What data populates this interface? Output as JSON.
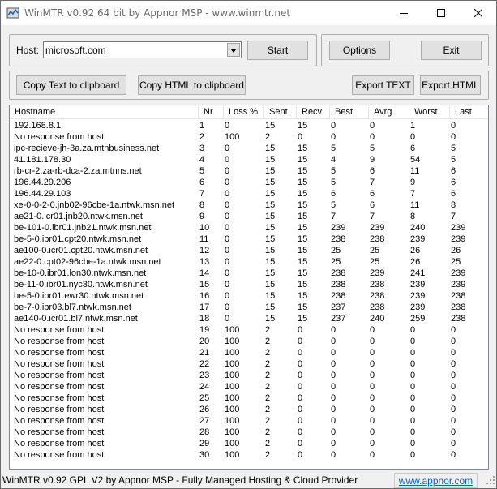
{
  "window": {
    "title": "WinMTR v0.92 64 bit by Appnor MSP - www.winmtr.net"
  },
  "host": {
    "label": "Host:",
    "value": "microsoft.com"
  },
  "buttons": {
    "start": "Start",
    "options": "Options",
    "exit": "Exit",
    "copy_text": "Copy Text to clipboard",
    "copy_html": "Copy HTML to clipboard",
    "export_text": "Export TEXT",
    "export_html": "Export HTML"
  },
  "table": {
    "columns": [
      "Hostname",
      "Nr",
      "Loss %",
      "Sent",
      "Recv",
      "Best",
      "Avrg",
      "Worst",
      "Last"
    ],
    "rows": [
      [
        "192.168.8.1",
        "1",
        "0",
        "15",
        "15",
        "0",
        "0",
        "1",
        "0"
      ],
      [
        "No response from host",
        "2",
        "100",
        "2",
        "0",
        "0",
        "0",
        "0",
        "0"
      ],
      [
        "ipc-recieve-jh-3a.za.mtnbusiness.net",
        "3",
        "0",
        "15",
        "15",
        "5",
        "5",
        "6",
        "5"
      ],
      [
        "41.181.178.30",
        "4",
        "0",
        "15",
        "15",
        "4",
        "9",
        "54",
        "5"
      ],
      [
        "rb-cr-2.za-rb-dca-2.za.mtnns.net",
        "5",
        "0",
        "15",
        "15",
        "5",
        "6",
        "11",
        "6"
      ],
      [
        "196.44.29.206",
        "6",
        "0",
        "15",
        "15",
        "5",
        "7",
        "9",
        "6"
      ],
      [
        "196.44.29.103",
        "7",
        "0",
        "15",
        "15",
        "6",
        "6",
        "7",
        "6"
      ],
      [
        "xe-0-0-2-0.jnb02-96cbe-1a.ntwk.msn.net",
        "8",
        "0",
        "15",
        "15",
        "5",
        "6",
        "11",
        "8"
      ],
      [
        "ae21-0.icr01.jnb20.ntwk.msn.net",
        "9",
        "0",
        "15",
        "15",
        "7",
        "7",
        "8",
        "7"
      ],
      [
        "be-101-0.ibr01.jnb21.ntwk.msn.net",
        "10",
        "0",
        "15",
        "15",
        "239",
        "239",
        "240",
        "239"
      ],
      [
        "be-5-0.ibr01.cpt20.ntwk.msn.net",
        "11",
        "0",
        "15",
        "15",
        "238",
        "238",
        "239",
        "239"
      ],
      [
        "ae100-0.icr01.cpt20.ntwk.msn.net",
        "12",
        "0",
        "15",
        "15",
        "25",
        "25",
        "26",
        "26"
      ],
      [
        "ae22-0.cpt02-96cbe-1a.ntwk.msn.net",
        "13",
        "0",
        "15",
        "15",
        "25",
        "25",
        "26",
        "25"
      ],
      [
        "be-10-0.ibr01.lon30.ntwk.msn.net",
        "14",
        "0",
        "15",
        "15",
        "238",
        "239",
        "241",
        "239"
      ],
      [
        "be-11-0.ibr01.nyc30.ntwk.msn.net",
        "15",
        "0",
        "15",
        "15",
        "238",
        "238",
        "239",
        "239"
      ],
      [
        "be-5-0.ibr01.ewr30.ntwk.msn.net",
        "16",
        "0",
        "15",
        "15",
        "238",
        "238",
        "239",
        "238"
      ],
      [
        "be-7-0.ibr03.bl7.ntwk.msn.net",
        "17",
        "0",
        "15",
        "15",
        "237",
        "238",
        "239",
        "238"
      ],
      [
        "ae140-0.icr01.bl7.ntwk.msn.net",
        "18",
        "0",
        "15",
        "15",
        "237",
        "240",
        "259",
        "238"
      ],
      [
        "No response from host",
        "19",
        "100",
        "2",
        "0",
        "0",
        "0",
        "0",
        "0"
      ],
      [
        "No response from host",
        "20",
        "100",
        "2",
        "0",
        "0",
        "0",
        "0",
        "0"
      ],
      [
        "No response from host",
        "21",
        "100",
        "2",
        "0",
        "0",
        "0",
        "0",
        "0"
      ],
      [
        "No response from host",
        "22",
        "100",
        "2",
        "0",
        "0",
        "0",
        "0",
        "0"
      ],
      [
        "No response from host",
        "23",
        "100",
        "2",
        "0",
        "0",
        "0",
        "0",
        "0"
      ],
      [
        "No response from host",
        "24",
        "100",
        "2",
        "0",
        "0",
        "0",
        "0",
        "0"
      ],
      [
        "No response from host",
        "25",
        "100",
        "2",
        "0",
        "0",
        "0",
        "0",
        "0"
      ],
      [
        "No response from host",
        "26",
        "100",
        "2",
        "0",
        "0",
        "0",
        "0",
        "0"
      ],
      [
        "No response from host",
        "27",
        "100",
        "2",
        "0",
        "0",
        "0",
        "0",
        "0"
      ],
      [
        "No response from host",
        "28",
        "100",
        "2",
        "0",
        "0",
        "0",
        "0",
        "0"
      ],
      [
        "No response from host",
        "29",
        "100",
        "2",
        "0",
        "0",
        "0",
        "0",
        "0"
      ],
      [
        "No response from host",
        "30",
        "100",
        "2",
        "0",
        "0",
        "0",
        "0",
        "0"
      ]
    ]
  },
  "status": {
    "text": "WinMTR v0.92 GPL V2 by Appnor MSP - Fully Managed Hosting & Cloud Provider",
    "link": "www.appnor.com"
  },
  "icons": {
    "app": "winmtr-icon",
    "minimize": "minimize-icon",
    "maximize": "maximize-icon",
    "close": "close-icon",
    "dropdown": "chevron-down-icon",
    "grip": "resize-grip-icon"
  }
}
